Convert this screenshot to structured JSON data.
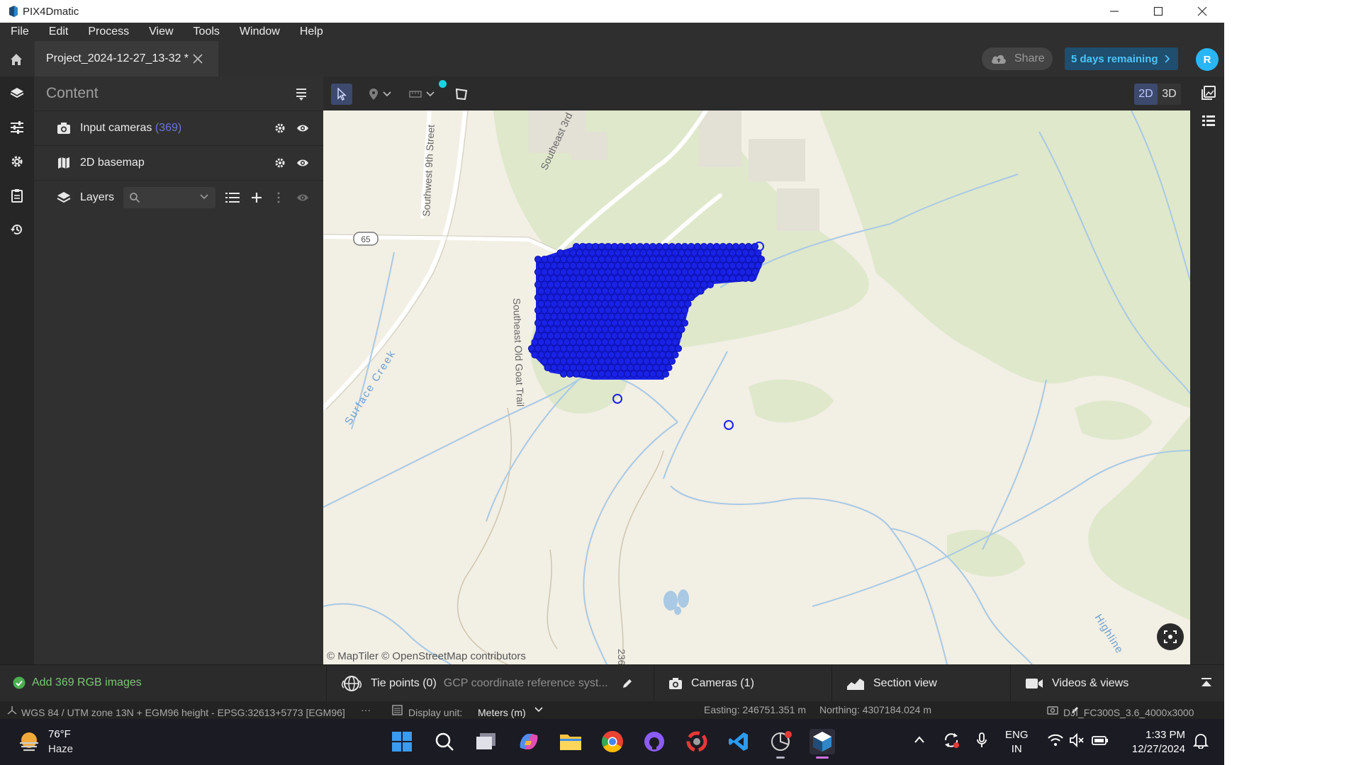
{
  "window": {
    "title": "PIX4Dmatic"
  },
  "menu": [
    "File",
    "Edit",
    "Process",
    "View",
    "Tools",
    "Window",
    "Help"
  ],
  "tab": {
    "label": "Project_2024-12-27_13-32 *"
  },
  "header": {
    "share_label": "Share",
    "trial_label": "5 days remaining",
    "avatar_initial": "R"
  },
  "panel": {
    "title": "Content",
    "rows": [
      {
        "label": "Input cameras",
        "count": "(369)",
        "icon": "camera-icon"
      },
      {
        "label": "2D basemap",
        "icon": "map-icon"
      },
      {
        "label": "Layers",
        "icon": "layers-icon"
      }
    ]
  },
  "map": {
    "view_modes": [
      "2D",
      "3D"
    ],
    "active_view": "2D",
    "attribution": "© MapTiler  © OpenStreetMap contributors",
    "labels": {
      "street_1": "Southwest 9th Street",
      "street_2": "Southeast 3rd",
      "trail": "Southeast Old Goat Trail",
      "creek": "Surface Creek",
      "route_shield": "65",
      "highline": "Highline",
      "route_236": "236"
    },
    "camera_marker_color": "#1a22e6",
    "water_color": "#a9c9e4",
    "vegetation_color": "#dde8c8"
  },
  "status": {
    "message": "Add 369 RGB images",
    "tie_points_label": "Tie points (0)",
    "gcp_label": "GCP coordinate reference syst...",
    "cameras_label": "Cameras (1)",
    "section_label": "Section view",
    "videos_label": "Videos & views"
  },
  "info": {
    "crs": "WGS 84 / UTM zone 13N + EGM96 height - EPSG:32613+5773 [EGM96]",
    "more": "···",
    "display_unit_label": "Display unit:",
    "display_unit_value": "Meters (m)",
    "easting": "Easting: 246751.351 m",
    "northing": "Northing: 4307184.024 m",
    "camera_model": "DJI_FC300S_3.6_4000x3000"
  },
  "taskbar": {
    "temperature": "76°F",
    "condition": "Haze",
    "lang_1": "ENG",
    "lang_2": "IN",
    "time": "1:33 PM",
    "date": "12/27/2024"
  }
}
